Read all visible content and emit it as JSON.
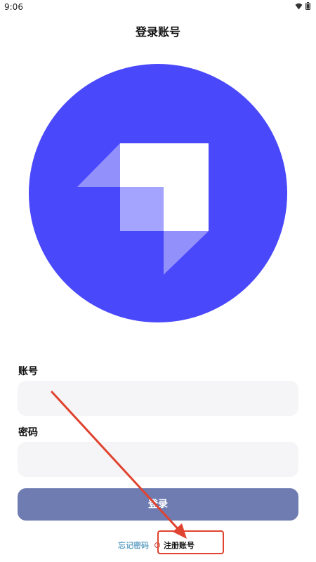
{
  "status_bar": {
    "time": "9:06",
    "icons": [
      "wifi-icon",
      "battery-icon"
    ]
  },
  "header": {
    "title": "登录账号"
  },
  "logo": {
    "circle_color": "#4a48fb",
    "mark_color": "#ffffff"
  },
  "form": {
    "account_label": "账号",
    "account_value": "",
    "password_label": "密码",
    "password_value": "",
    "login_label": "登录",
    "login_color": "#6f7cb2"
  },
  "links": {
    "forgot_password": "忘记密码",
    "register": "注册账号"
  },
  "annotation": {
    "color": "#e0432f",
    "shapes": [
      "arrow",
      "highlight-box"
    ]
  }
}
